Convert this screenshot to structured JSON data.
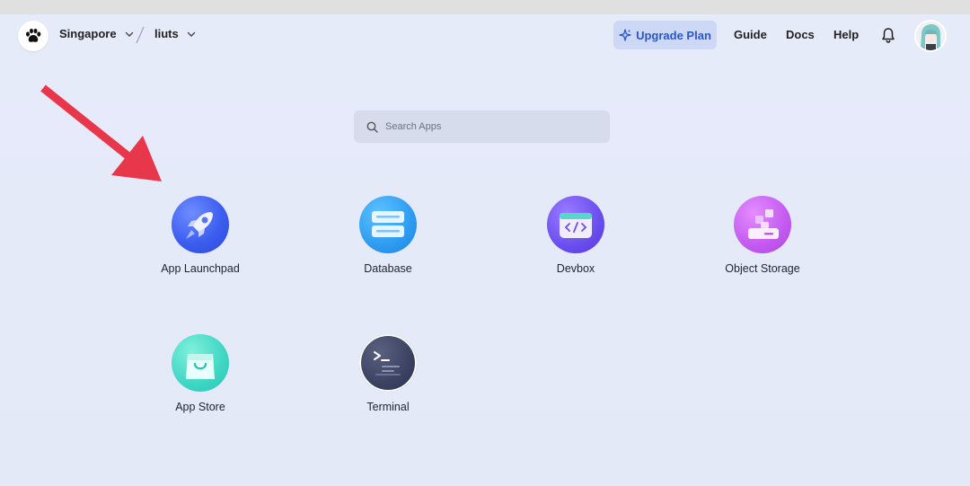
{
  "header": {
    "region": "Singapore",
    "namespace": "liuts",
    "upgrade_label": "Upgrade Plan",
    "nav": [
      "Guide",
      "Docs",
      "Help"
    ]
  },
  "search": {
    "placeholder": "Search Apps"
  },
  "apps": [
    {
      "label": "App Launchpad",
      "icon": "rocket-icon"
    },
    {
      "label": "Database",
      "icon": "database-icon"
    },
    {
      "label": "Devbox",
      "icon": "devbox-code-icon"
    },
    {
      "label": "Object Storage",
      "icon": "object-storage-icon"
    },
    {
      "label": "App Store",
      "icon": "shopping-bag-icon"
    },
    {
      "label": "Terminal",
      "icon": "terminal-icon"
    }
  ],
  "colors": {
    "accent": "#2a56c9",
    "annotation_arrow": "#e8364a",
    "background": "#e6ebfa"
  }
}
